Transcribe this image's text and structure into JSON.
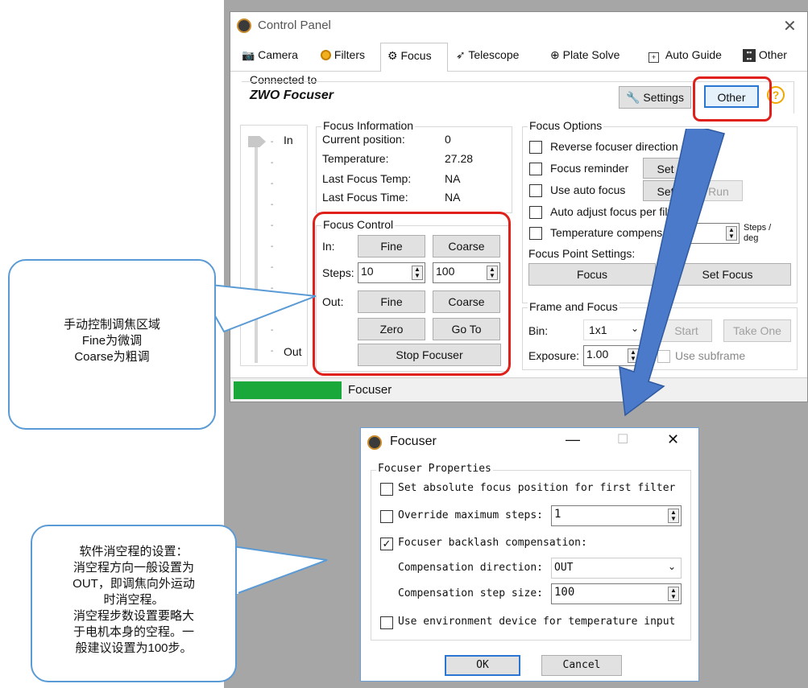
{
  "main_window": {
    "title": "Control Panel",
    "tabs": [
      "Camera",
      "Filters",
      "Focus",
      "Telescope",
      "Plate Solve",
      "Auto Guide",
      "Other"
    ],
    "active_tab": "Focus",
    "connected_label": "Connected to",
    "device_name": "ZWO Focuser",
    "settings_label": "Settings",
    "other_label": "Other",
    "help_glyph": "?",
    "slider": {
      "in_label": "In",
      "out_label": "Out"
    },
    "focus_info": {
      "title": "Focus Information",
      "rows": [
        {
          "label": "Current position:",
          "value": "0"
        },
        {
          "label": "Temperature:",
          "value": "27.28"
        },
        {
          "label": "Last Focus Temp:",
          "value": "NA"
        },
        {
          "label": "Last Focus Time:",
          "value": "NA"
        }
      ]
    },
    "focus_control": {
      "title": "Focus Control",
      "in_label": "In:",
      "steps_label": "Steps:",
      "out_label": "Out:",
      "fine": "Fine",
      "coarse": "Coarse",
      "steps_fine": "10",
      "steps_coarse": "100",
      "zero": "Zero",
      "goto": "Go To",
      "stop": "Stop Focuser"
    },
    "focus_options": {
      "title": "Focus Options",
      "reverse": "Reverse focuser direction",
      "reminder": "Focus reminder",
      "auto_focus": "Use auto focus",
      "auto_adjust": "Auto adjust focus per filter",
      "temp_comp": "Temperature compensati",
      "set": "Set",
      "run": "Run",
      "steps_deg": "Steps / deg",
      "point_settings": "Focus Point Settings:",
      "focus": "Focus",
      "set_focus": "Set Focus"
    },
    "frame_focus": {
      "title": "Frame and Focus",
      "bin_label": "Bin:",
      "bin_value": "1x1",
      "start": "Start",
      "take_one": "Take One",
      "exposure_label": "Exposure:",
      "exposure_value": "1.00",
      "use_subframe": "Use subframe"
    },
    "status_text": "Focuser"
  },
  "focuser_dialog": {
    "title": "Focuser",
    "group_title": "Focuser Properties",
    "set_absolute": "Set absolute focus position for first filter",
    "override_max": "Override maximum steps:",
    "override_value": "1",
    "backlash": "Focuser backlash compensation:",
    "backlash_checked": true,
    "comp_direction_label": "Compensation direction:",
    "comp_direction_value": "OUT",
    "comp_step_label": "Compensation step size:",
    "comp_step_value": "100",
    "use_env": "Use environment device for temperature input",
    "ok": "OK",
    "cancel": "Cancel"
  },
  "callouts": {
    "focus_control_note": [
      "手动控制调焦区域",
      "Fine为微调",
      "Coarse为粗调"
    ],
    "backlash_note": [
      "软件消空程的设置：",
      "消空程方向一般设置为",
      "OUT，即调焦向外运动",
      "时消空程。",
      "消空程步数设置要略大",
      "于电机本身的空程。一",
      "般建议设置为100步。"
    ]
  },
  "colors": {
    "highlight_red": "#e0201b",
    "arrow_blue": "#4a7ac9",
    "progress_green": "#1aa83a",
    "backdrop_gray": "#a6a6a6",
    "callout_border": "#5b9bd5"
  },
  "icons": {
    "app": "aperture-icon",
    "camera": "camera-icon",
    "filters": "filter-wheel-icon",
    "focus": "gear-icon",
    "telescope": "telescope-icon",
    "plate_solve": "globe-icon",
    "auto_guide": "crosshair-icon",
    "other": "grid-icon",
    "settings": "wrench-icon",
    "help": "help-icon",
    "close": "close-icon"
  }
}
